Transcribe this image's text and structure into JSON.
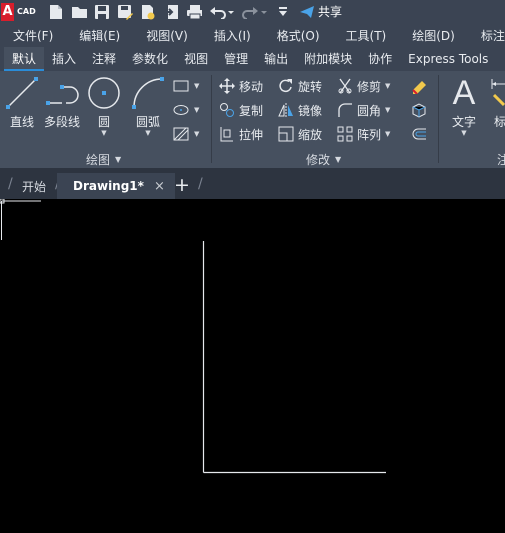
{
  "app": {
    "logo_letter": "A",
    "logo_text": "CAD"
  },
  "quick_access": {
    "share_label": "共享"
  },
  "menu": [
    "文件(F)",
    "编辑(E)",
    "视图(V)",
    "插入(I)",
    "格式(O)",
    "工具(T)",
    "绘图(D)",
    "标注(N)"
  ],
  "ribbon_tabs": [
    "默认",
    "插入",
    "注释",
    "参数化",
    "视图",
    "管理",
    "输出",
    "附加模块",
    "协作",
    "Express Tools"
  ],
  "active_ribbon_tab": "默认",
  "draw_panel": {
    "title": "绘图",
    "tools": {
      "line": "直线",
      "polyline": "多段线",
      "circle": "圆",
      "arc": "圆弧"
    }
  },
  "modify_panel": {
    "title": "修改",
    "move": "移动",
    "rotate": "旋转",
    "trim": "修剪",
    "copy": "复制",
    "mirror": "镜像",
    "fillet": "圆角",
    "stretch": "拉伸",
    "scale": "缩放",
    "array": "阵列"
  },
  "annotation_panel": {
    "text": "文字",
    "dimension": "标注",
    "title": "注"
  },
  "doc_tabs": {
    "start": "开始",
    "active": "Drawing1*",
    "close": "×",
    "add": "+"
  },
  "colors": {
    "chrome": "#3b4453",
    "ribbon": "#46505f",
    "accent": "#2a8cd8",
    "canvas": "#000000",
    "logo_red": "#d81e2c"
  }
}
